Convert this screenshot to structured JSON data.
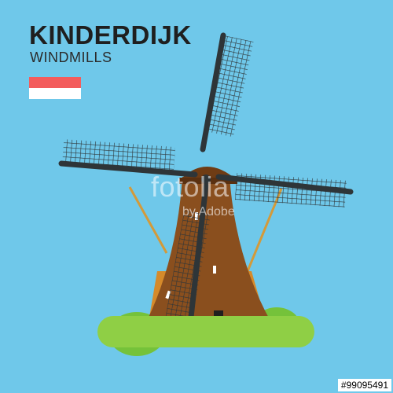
{
  "title": "KINDERDIJK",
  "subtitle": "WINDMILLS",
  "flag": {
    "stripes": [
      "#f35c5c",
      "#ffffff",
      "#6fc8ea"
    ]
  },
  "watermark": {
    "main": "fotolia",
    "sub": "by Adobe"
  },
  "stock_id": "#99095491",
  "colors": {
    "background": "#6fc8ea",
    "mill_body": "#8a4f1e",
    "mill_base": "#d58a2a",
    "sails": "#2e3538",
    "grass": "#8fcf45",
    "bush": "#75c23a"
  }
}
